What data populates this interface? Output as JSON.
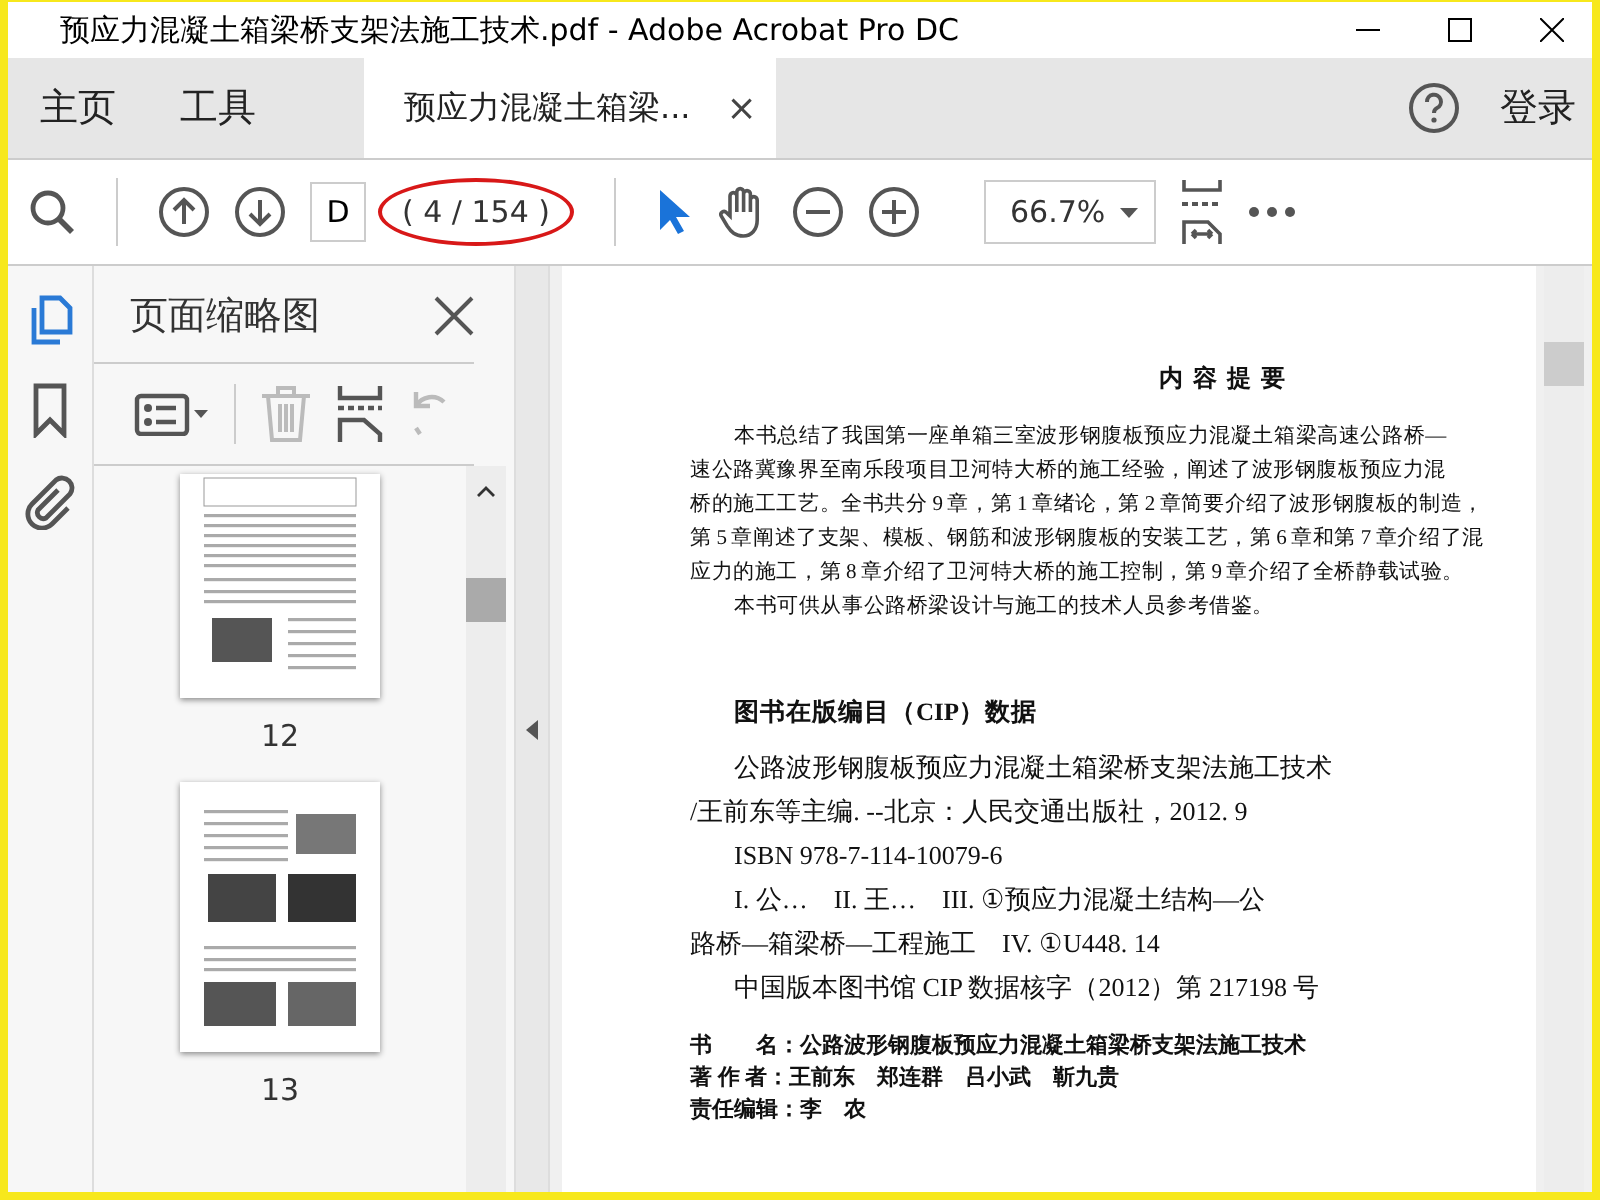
{
  "window": {
    "title": "预应力混凝土箱梁桥支架法施工技术.pdf - Adobe Acrobat Pro DC"
  },
  "nav": [
    {
      "label": "主页",
      "selected": false
    },
    {
      "label": "工具",
      "selected": false
    }
  ],
  "document_tab": {
    "label": "预应力混凝土箱梁...",
    "close": "×",
    "selected": true
  },
  "account": {
    "label": "登录"
  },
  "toolbar": {
    "page_field": "D",
    "page_count": "( 4 / 154 )",
    "zoom": "66.7%",
    "pointer_selected": true
  },
  "rail": [
    {
      "kind": "pages",
      "selected": true
    },
    {
      "kind": "bookmarks",
      "selected": false
    },
    {
      "kind": "attachments",
      "selected": false
    }
  ],
  "panel": {
    "title": "页面缩略图",
    "thumbnails": [
      {
        "label": "12",
        "kind": "text"
      },
      {
        "label": "13",
        "kind": "photos"
      }
    ]
  },
  "document": {
    "heading": "内 容 提 要",
    "summary": [
      "本书总结了我国第一座单箱三室波形钢腹板预应力混凝土箱梁高速公路桥—",
      "速公路冀豫界至南乐段项目卫河特大桥的施工经验，阐述了波形钢腹板预应力混",
      "桥的施工工艺。全书共分 9 章，第 1 章绪论，第 2 章简要介绍了波形钢腹板的制造，",
      "第 5 章阐述了支架、模板、钢筋和波形钢腹板的安装工艺，第 6 章和第 7 章介绍了混",
      "应力的施工，第 8 章介绍了卫河特大桥的施工控制，第 9 章介绍了全桥静载试验。"
    ],
    "audience": "本书可供从事公路桥梁设计与施工的技术人员参考借鉴。",
    "cip_heading": "图书在版编目（CIP）数据",
    "cip_lines": [
      {
        "text": "公路波形钢腹板预应力混凝土箱梁桥支架法施工技术",
        "indent": true
      },
      {
        "text": "/王前东等主编. --北京：人民交通出版社，2012. 9",
        "indent": false
      },
      {
        "text": "ISBN 978-7-114-10079-6",
        "indent": true
      },
      {
        "text": "I. 公…　II. 王…　III. ①预应力混凝土结构—公",
        "indent": true
      },
      {
        "text": "路桥—箱梁桥—工程施工　IV. ①U448. 14",
        "indent": false
      },
      {
        "text": "中国版本图书馆 CIP 数据核字（2012）第 217198 号",
        "indent": true
      }
    ],
    "credits": [
      {
        "label": "书　　名：",
        "value": "公路波形钢腹板预应力混凝土箱梁桥支架法施工技术"
      },
      {
        "label": "著 作 者：",
        "value": "王前东　郑连群　吕小武　靳九贵"
      },
      {
        "label": "责任编辑：",
        "value": "李　农"
      }
    ]
  }
}
